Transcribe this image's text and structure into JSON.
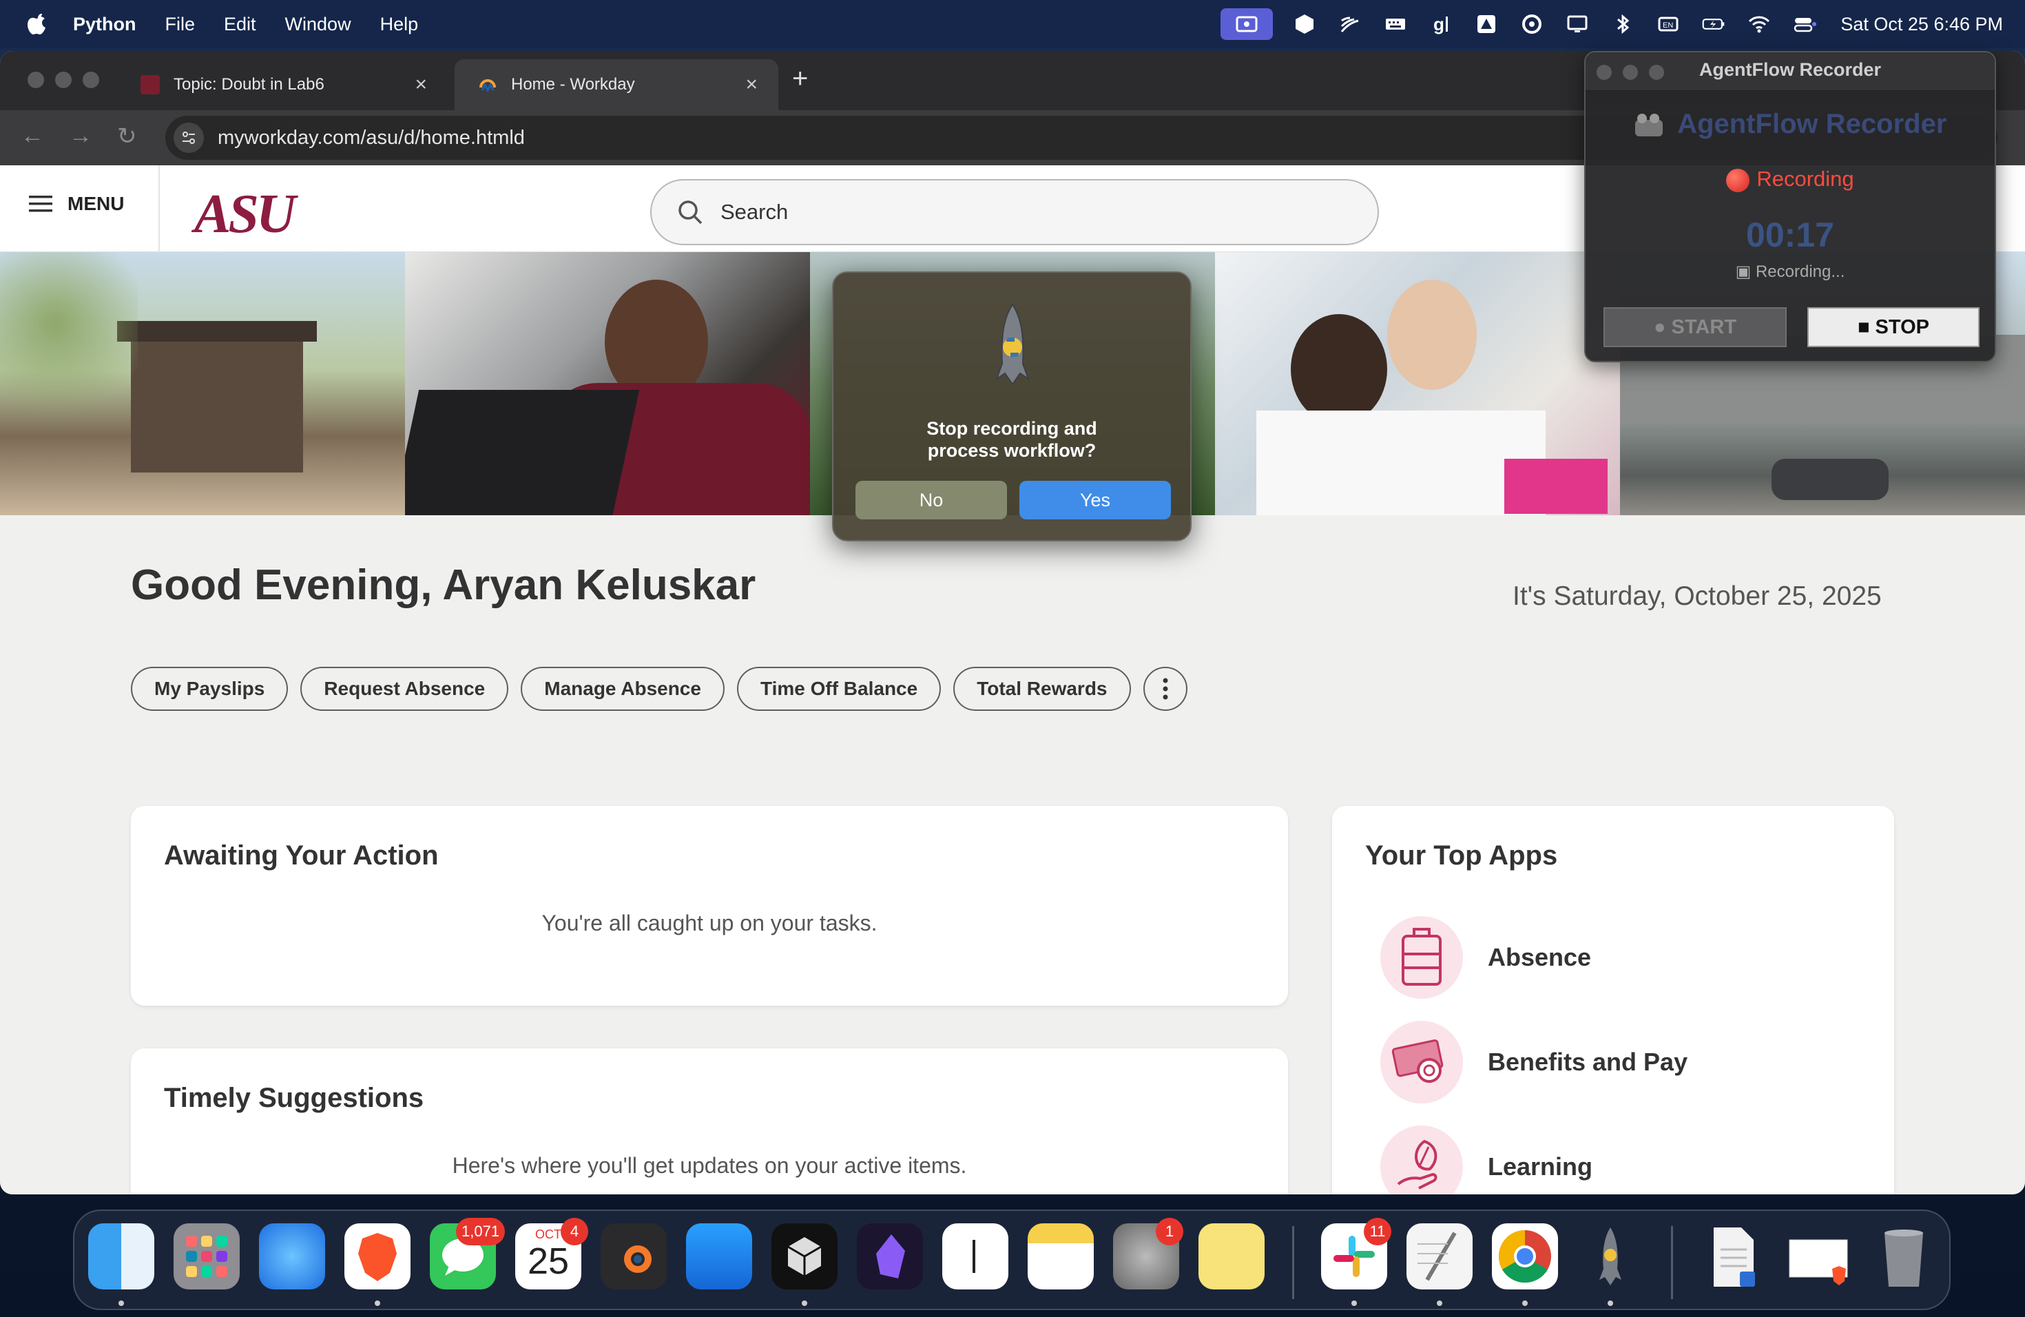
{
  "menubar": {
    "app_name": "Python",
    "menus": [
      "File",
      "Edit",
      "Window",
      "Help"
    ],
    "clock": "Sat Oct 25  6:46 PM"
  },
  "browser": {
    "tabs": [
      {
        "label": "Topic: Doubt in Lab6",
        "close": "×"
      },
      {
        "label": "Home - Workday",
        "close": "×"
      }
    ],
    "new_tab": "+",
    "url": "myworkday.com/asu/d/home.htmld"
  },
  "workday": {
    "menu_label": "MENU",
    "logo_text": "ASU",
    "search_placeholder": "Search",
    "greeting": "Good Evening, Aryan Keluskar",
    "date": "It's Saturday, October 25, 2025",
    "quick_actions": [
      "My Payslips",
      "Request Absence",
      "Manage Absence",
      "Time Off Balance",
      "Total Rewards"
    ],
    "awaiting": {
      "title": "Awaiting Your Action",
      "message": "You're all caught up on your tasks."
    },
    "timely": {
      "title": "Timely Suggestions",
      "message": "Here's where you'll get updates on your active items."
    },
    "top_apps": {
      "title": "Your Top Apps",
      "apps": [
        {
          "label": "Absence",
          "icon": "suitcase-icon"
        },
        {
          "label": "Benefits and Pay",
          "icon": "money-icon"
        },
        {
          "label": "Learning",
          "icon": "leaf-hand-icon"
        }
      ]
    },
    "accent_color": "#8c1d40"
  },
  "dialog": {
    "message": "Stop recording and\nprocess workflow?",
    "no_label": "No",
    "yes_label": "Yes"
  },
  "recorder": {
    "window_title": "AgentFlow Recorder",
    "app_title": "AgentFlow Recorder",
    "status": "Recording",
    "timer": "00:17",
    "sub_status": "Recording...",
    "start_label": "● START",
    "stop_label": "■ STOP"
  },
  "dock": {
    "badges": {
      "messages": "1,071",
      "calendar": "4",
      "settings": "1",
      "slack": "11"
    },
    "calendar_month": "OCT",
    "calendar_day": "25"
  }
}
